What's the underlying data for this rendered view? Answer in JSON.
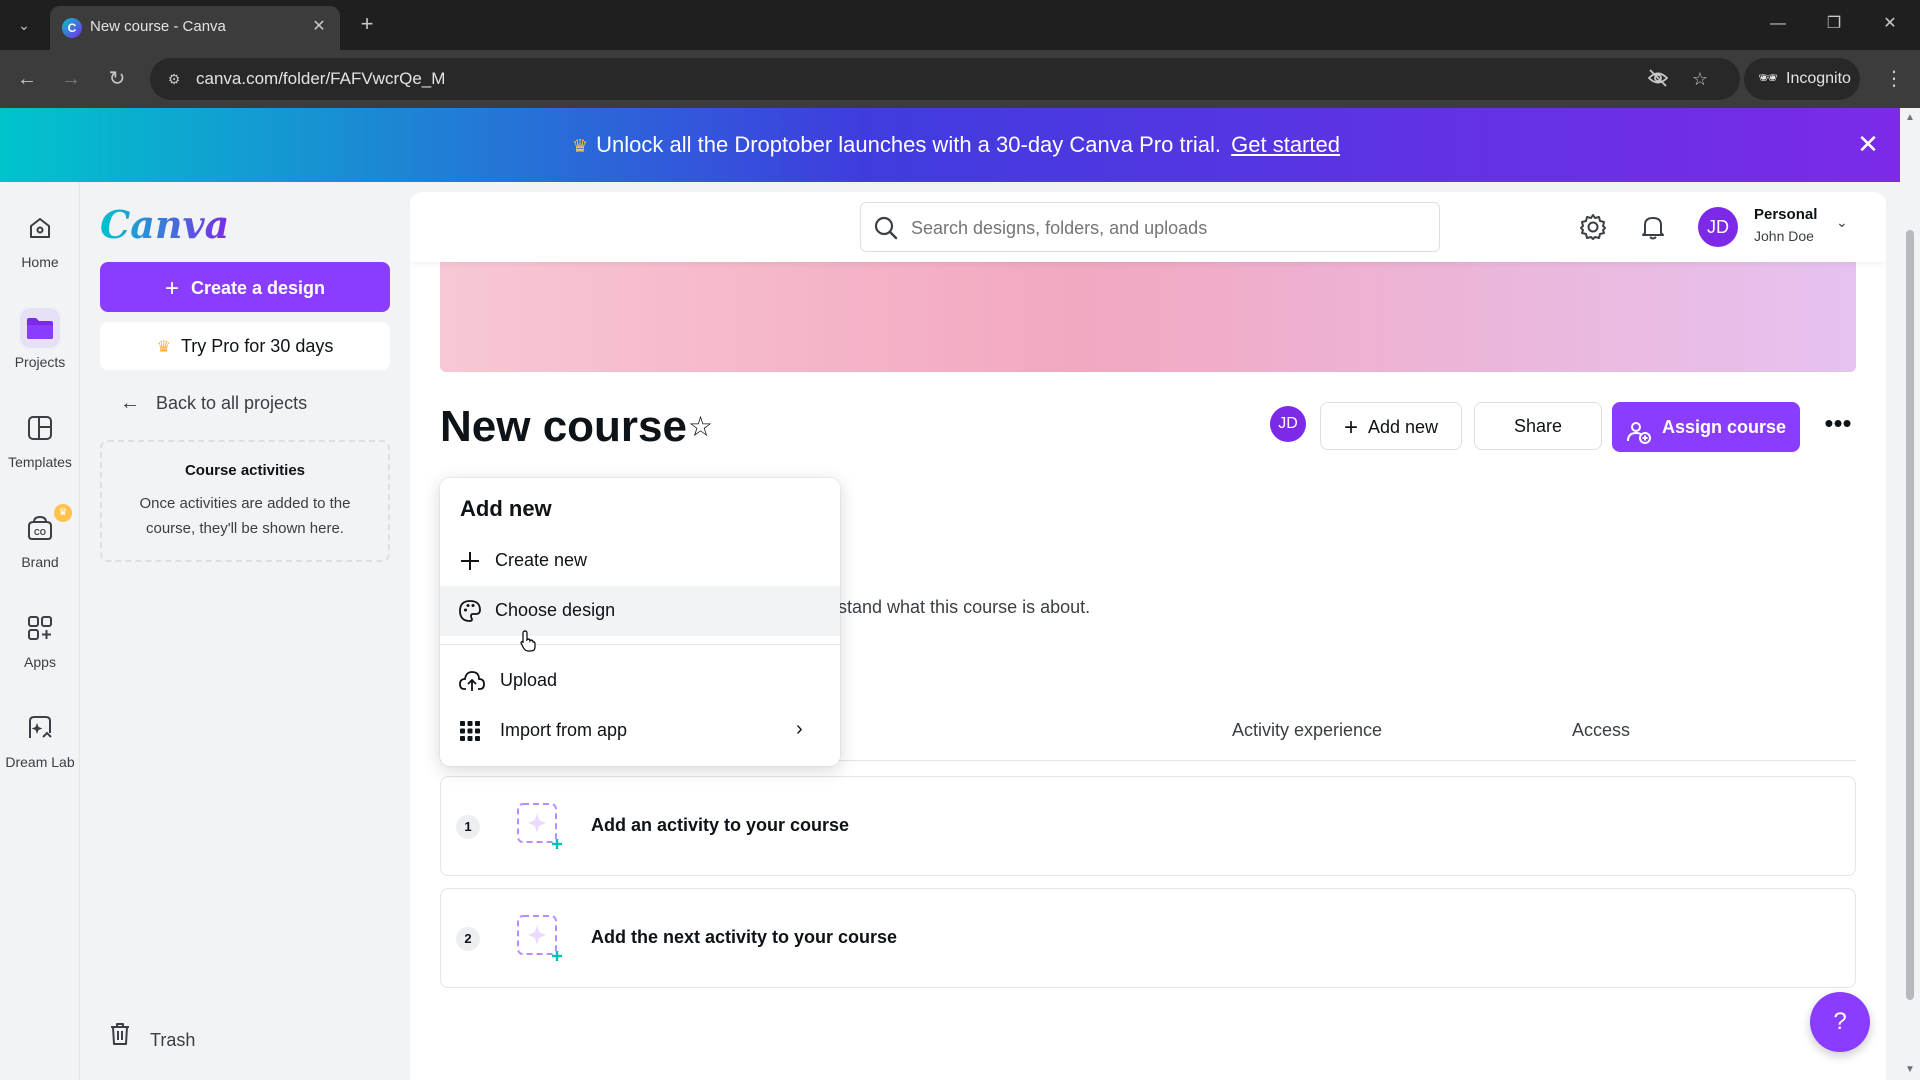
{
  "browser": {
    "tab_title": "New course - Canva",
    "url": "canva.com/folder/FAFVwcrQe_M",
    "incognito_label": "Incognito"
  },
  "banner": {
    "text": "Unlock all the Droptober launches with a 30-day Canva Pro trial.",
    "link": "Get started"
  },
  "rail": {
    "items": [
      {
        "label": "Home",
        "icon": "home-icon"
      },
      {
        "label": "Projects",
        "icon": "folder-icon"
      },
      {
        "label": "Templates",
        "icon": "templates-icon"
      },
      {
        "label": "Brand",
        "icon": "brand-icon"
      },
      {
        "label": "Apps",
        "icon": "apps-icon"
      },
      {
        "label": "Dream Lab",
        "icon": "dream-lab-icon"
      }
    ]
  },
  "sidebar": {
    "logo": "Canva",
    "create_label": "Create a design",
    "pro_label": "Try Pro for 30 days",
    "back_label": "Back to all projects",
    "activities_title": "Course activities",
    "activities_desc": "Once activities are added to the course, they'll be shown here.",
    "trash_label": "Trash"
  },
  "topbar": {
    "search_placeholder": "Search designs, folders, and uploads",
    "account_type": "Personal",
    "account_user": "John Doe",
    "avatar_initials": "JD"
  },
  "course": {
    "title": "New course",
    "collaborator_initials": "JD",
    "add_new_label": "Add new",
    "share_label": "Share",
    "assign_label": "Assign course",
    "description_partial": "stand what this course is about.",
    "columns": {
      "activity_experience": "Activity experience",
      "access": "Access"
    },
    "activities": [
      {
        "number": "1",
        "text": "Add an activity to your course"
      },
      {
        "number": "2",
        "text": "Add the next activity to your course"
      }
    ]
  },
  "dropdown": {
    "title": "Add new",
    "items": [
      {
        "label": "Create new",
        "icon": "plus-icon"
      },
      {
        "label": "Choose design",
        "icon": "palette-icon"
      },
      {
        "label": "Upload",
        "icon": "cloud-upload-icon"
      },
      {
        "label": "Import from app",
        "icon": "apps-grid-icon"
      }
    ]
  },
  "help_label": "?",
  "colors": {
    "accent": "#8b3dff",
    "banner_start": "#00c4cc",
    "banner_end": "#7d2ae8"
  }
}
